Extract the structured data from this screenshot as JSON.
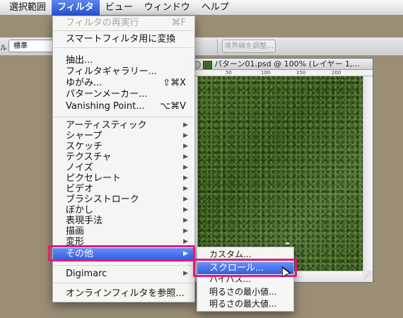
{
  "menubar": {
    "items": [
      {
        "label": "選択範囲",
        "active": false
      },
      {
        "label": "フィルタ",
        "active": true
      },
      {
        "label": "ビュー",
        "active": false
      },
      {
        "label": "ウィンドウ",
        "active": false
      },
      {
        "label": "ヘルプ",
        "active": false
      }
    ]
  },
  "options_bar": {
    "label": "ル：",
    "select_value": "標準",
    "refine_edge_button": "境界線を調整..."
  },
  "document": {
    "title": "パターン01.psd @ 100% (レイヤー 1,...",
    "ruler_ticks": [
      "50",
      "100",
      "150",
      "200"
    ]
  },
  "filter_menu": {
    "items": [
      {
        "label": "フィルタの再実行",
        "shortcut": "⌘F",
        "disabled": true
      },
      {
        "label": "スマートフィルタ用に変換"
      },
      {
        "label": "抽出..."
      },
      {
        "label": "フィルタギャラリー..."
      },
      {
        "label": "ゆがみ...",
        "shortcut": "⇧⌘X"
      },
      {
        "label": "パターンメーカー..."
      },
      {
        "label": "Vanishing Point...",
        "shortcut": "⌥⌘V"
      },
      {
        "label": "アーティスティック",
        "submenu": true
      },
      {
        "label": "シャープ",
        "submenu": true
      },
      {
        "label": "スケッチ",
        "submenu": true
      },
      {
        "label": "テクスチャ",
        "submenu": true
      },
      {
        "label": "ノイズ",
        "submenu": true
      },
      {
        "label": "ピクセレート",
        "submenu": true
      },
      {
        "label": "ビデオ",
        "submenu": true
      },
      {
        "label": "ブラシストローク",
        "submenu": true
      },
      {
        "label": "ぼかし",
        "submenu": true
      },
      {
        "label": "表現手法",
        "submenu": true
      },
      {
        "label": "描画",
        "submenu": true
      },
      {
        "label": "変形",
        "submenu": true
      },
      {
        "label": "その他",
        "submenu": true,
        "highlighted": true
      },
      {
        "label": "Digimarc",
        "submenu": true
      },
      {
        "label": "オンラインフィルタを参照..."
      }
    ]
  },
  "other_submenu": {
    "items": [
      {
        "label": "カスタム..."
      },
      {
        "label": "スクロール...",
        "highlighted": true
      },
      {
        "label": "ハイパス..."
      },
      {
        "label": "明るさの最小値..."
      },
      {
        "label": "明るさの最大値..."
      }
    ]
  },
  "colors": {
    "highlight": "#2f5ee2",
    "callout": "#e8187a",
    "background": "#9b8e76"
  }
}
